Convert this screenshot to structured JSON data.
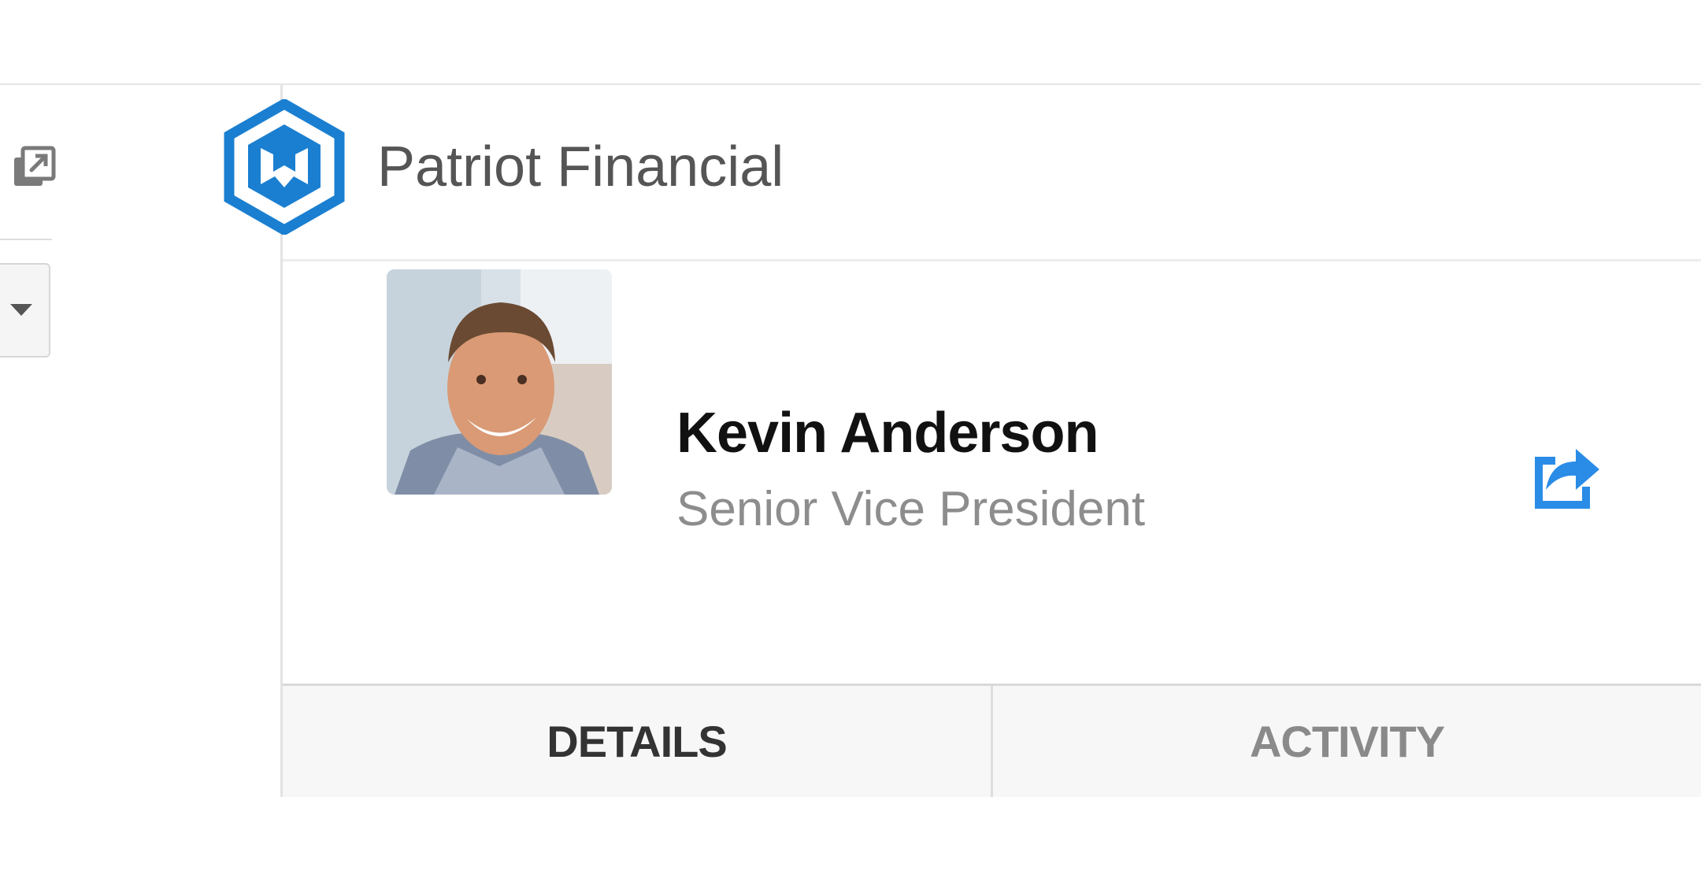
{
  "header": {
    "company_name": "Patriot Financial"
  },
  "profile": {
    "name": "Kevin Anderson",
    "title": "Senior Vice President"
  },
  "tabs": [
    {
      "label": "DETAILS",
      "active": true
    },
    {
      "label": "ACTIVITY",
      "active": false
    }
  ],
  "icons": {
    "logo": "hexagon-shield-logo",
    "popout": "popout-icon",
    "dropdown": "caret-down-icon",
    "share": "share-icon"
  },
  "colors": {
    "brand_blue": "#1a7fd1",
    "share_blue": "#2a8ce6"
  }
}
